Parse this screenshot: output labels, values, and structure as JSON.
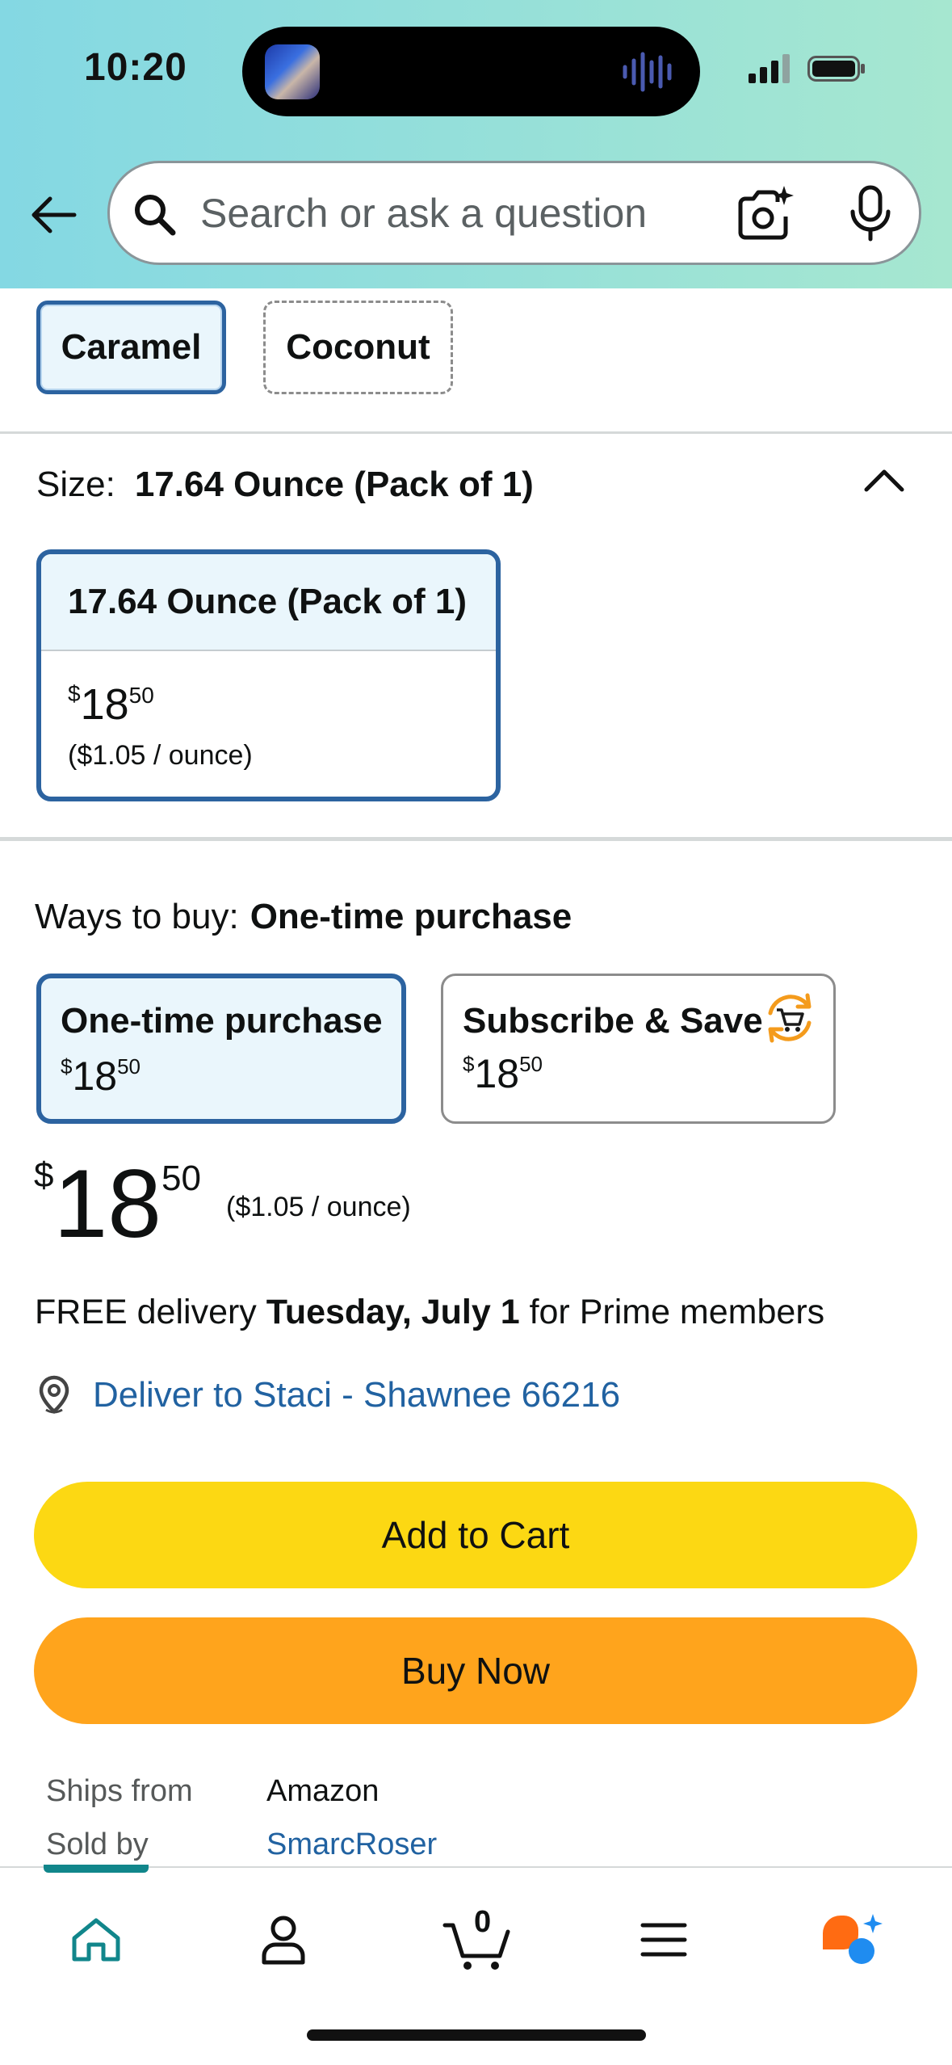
{
  "status_bar": {
    "time": "10:20"
  },
  "search": {
    "placeholder": "Search or ask a question"
  },
  "flavors": {
    "options": [
      "Caramel",
      "Coconut"
    ],
    "selected": "Caramel"
  },
  "size": {
    "label": "Size:",
    "selected": "17.64 Ounce (Pack of 1)",
    "option": {
      "title": "17.64 Ounce (Pack of 1)",
      "currency": "$",
      "price_whole": "18",
      "price_fraction": "50",
      "unit_price": "($1.05 / ounce)"
    }
  },
  "ways_to_buy": {
    "label": "Ways to buy:",
    "selected": "One-time purchase",
    "options": [
      {
        "title": "One-time purchase",
        "currency": "$",
        "price_whole": "18",
        "price_fraction": "50"
      },
      {
        "title": "Subscribe & Save",
        "currency": "$",
        "price_whole": "18",
        "price_fraction": "50"
      }
    ]
  },
  "price": {
    "currency": "$",
    "whole": "18",
    "fraction": "50",
    "unit_price": "($1.05 / ounce)"
  },
  "delivery": {
    "prefix": "FREE delivery ",
    "date": "Tuesday, July 1",
    "suffix": " for Prime members",
    "location": "Deliver to Staci - Shawnee 66216"
  },
  "actions": {
    "add_to_cart": "Add to Cart",
    "buy_now": "Buy Now"
  },
  "seller_info": {
    "ships_from_label": "Ships from",
    "ships_from_value": "Amazon",
    "sold_by_label": "Sold by",
    "sold_by_value": "SmarcRoser"
  },
  "bottom_nav": {
    "items": [
      "home-icon",
      "account-icon",
      "cart-icon",
      "menu-icon",
      "rufus-icon"
    ],
    "cart_count": "0",
    "active": "home"
  },
  "colors": {
    "header_gradient_start": "#84d8e3",
    "header_gradient_end": "#a6e7d0",
    "selected_border": "#2c63a0",
    "selected_fill": "#eaf6fc",
    "link": "#2162a1",
    "add_to_cart": "#fcd813",
    "buy_now": "#ffa41c",
    "nav_accent": "#11868b"
  }
}
